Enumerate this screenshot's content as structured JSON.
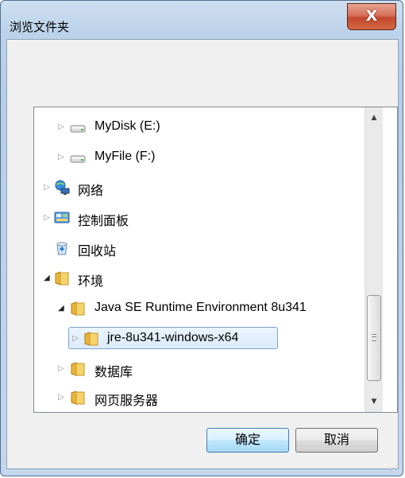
{
  "window": {
    "title": "浏览文件夹",
    "close_label": "X"
  },
  "tree": {
    "items": [
      {
        "label": "MyDisk (E:)",
        "icon": "drive-icon",
        "expander": "collapsed"
      },
      {
        "label": "MyFile (F:)",
        "icon": "drive-icon",
        "expander": "collapsed"
      },
      {
        "label": "网络",
        "icon": "network-icon",
        "expander": "collapsed"
      },
      {
        "label": "控制面板",
        "icon": "control-panel-icon",
        "expander": "collapsed"
      },
      {
        "label": "回收站",
        "icon": "recycle-bin-icon",
        "expander": "none"
      },
      {
        "label": "环境",
        "icon": "folder-icon",
        "expander": "expanded"
      },
      {
        "label": "Java SE Runtime Environment 8u341",
        "icon": "folder-icon",
        "expander": "expanded"
      },
      {
        "label": "jre-8u341-windows-x64",
        "icon": "folder-icon",
        "expander": "collapsed",
        "selected": true
      },
      {
        "label": "数据库",
        "icon": "folder-icon",
        "expander": "collapsed"
      },
      {
        "label": "网页服务器",
        "icon": "folder-icon",
        "expander": "collapsed"
      }
    ]
  },
  "buttons": {
    "ok": "确定",
    "cancel": "取消"
  },
  "colors": {
    "selection_border": "#7da2ce",
    "selection_fill": "#dcebfc",
    "folder": "#f2c84b",
    "close_button": "#c2472c"
  }
}
